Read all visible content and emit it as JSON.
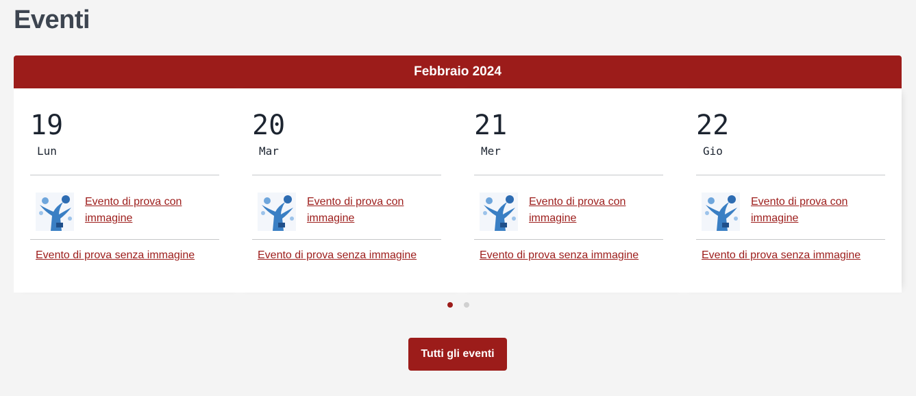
{
  "page": {
    "title": "Eventi"
  },
  "calendar": {
    "month": "Febbraio 2024",
    "days": [
      {
        "number": "19",
        "name": "Lun",
        "event_with_image": "Evento di prova con immagine",
        "event_without_image": "Evento di prova senza immagine"
      },
      {
        "number": "20",
        "name": "Mar",
        "event_with_image": "Evento di prova con immagine",
        "event_without_image": "Evento di prova senza immagine"
      },
      {
        "number": "21",
        "name": "Mer",
        "event_with_image": "Evento di prova con immagine",
        "event_without_image": "Evento di prova senza immagine"
      },
      {
        "number": "22",
        "name": "Gio",
        "event_with_image": "Evento di prova con immagine",
        "event_without_image": "Evento di prova senza immagine"
      }
    ]
  },
  "pagination": {
    "pages": 2,
    "active": 1
  },
  "actions": {
    "all_events_label": "Tutti gli eventi"
  },
  "colors": {
    "accent": "#9c1c1a",
    "heading": "#3d4550",
    "background": "#f4f4f4"
  },
  "icons": {
    "event_thumbnail": "tree-illustration-icon"
  }
}
